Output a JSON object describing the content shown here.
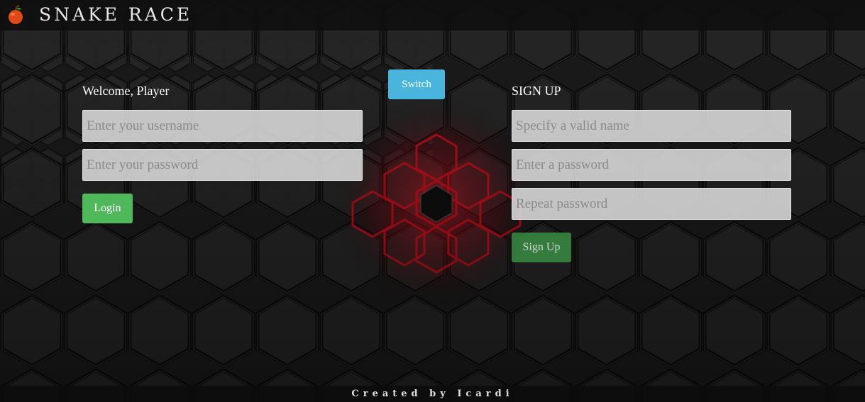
{
  "app": {
    "title": "SNAKE RACE",
    "logo_icon": "apple-icon"
  },
  "login": {
    "heading": "Welcome, Player",
    "username_placeholder": "Enter your username",
    "password_placeholder": "Enter your password",
    "button_label": "Login"
  },
  "switch": {
    "button_label": "Switch"
  },
  "signup": {
    "heading": "SIGN UP",
    "name_placeholder": "Specify a valid name",
    "password_placeholder": "Enter a password",
    "repeat_placeholder": "Repeat password",
    "button_label": "Sign Up"
  },
  "footer": {
    "credit": "Created by Icardi"
  },
  "colors": {
    "login_button": "#4fb85a",
    "switch_button": "#4ab5dc",
    "glow": "#d0101e"
  }
}
